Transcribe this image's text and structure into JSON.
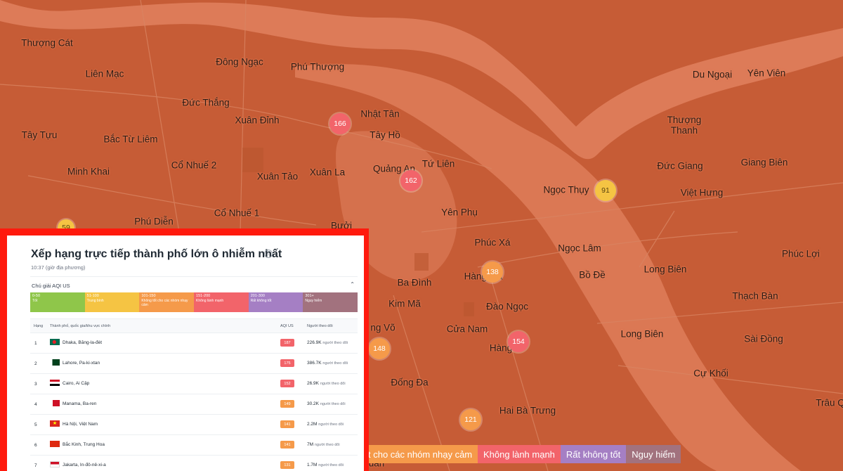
{
  "map": {
    "places": [
      {
        "id": "thuong-cat",
        "label": "Thượng Cát"
      },
      {
        "id": "dong-ngac",
        "label": "Đông Ngạc"
      },
      {
        "id": "phu-thuong",
        "label": "Phú Thượng"
      },
      {
        "id": "lien-mac",
        "label": "Liên Mạc"
      },
      {
        "id": "du-ngoai",
        "label": "Du Ngoại"
      },
      {
        "id": "yen-vien",
        "label": "Yên Viên"
      },
      {
        "id": "duc-thang",
        "label": "Đức Thắng"
      },
      {
        "id": "nhat-tan",
        "label": "Nhật Tân"
      },
      {
        "id": "xuan-dinh",
        "label": "Xuân Đỉnh"
      },
      {
        "id": "thuong-thanh",
        "label": "Thượng Thanh"
      },
      {
        "id": "tay-tuu",
        "label": "Tây Tựu"
      },
      {
        "id": "bac-tu-liem",
        "label": "Bắc Từ Liêm"
      },
      {
        "id": "tay-ho",
        "label": "Tây Hồ"
      },
      {
        "id": "co-nhue-2",
        "label": "Cổ Nhuế 2"
      },
      {
        "id": "duc-giang",
        "label": "Đức Giang"
      },
      {
        "id": "giang-bien",
        "label": "Giang Biên"
      },
      {
        "id": "tu-lien",
        "label": "Tứ Liên"
      },
      {
        "id": "minh-khai",
        "label": "Minh Khai"
      },
      {
        "id": "quang-an",
        "label": "Quảng An"
      },
      {
        "id": "xuan-la",
        "label": "Xuân La"
      },
      {
        "id": "xuan-tao",
        "label": "Xuân Tảo"
      },
      {
        "id": "ngoc-thuy",
        "label": "Ngọc Thụy"
      },
      {
        "id": "viet-hung",
        "label": "Việt Hưng"
      },
      {
        "id": "yen-phu",
        "label": "Yên Phụ"
      },
      {
        "id": "co-nhue-1",
        "label": "Cổ Nhuế 1"
      },
      {
        "id": "phu-dien",
        "label": "Phú Diễn"
      },
      {
        "id": "buoi",
        "label": "Bưởi"
      },
      {
        "id": "phuc-xa",
        "label": "Phúc Xá"
      },
      {
        "id": "ngoc-lam",
        "label": "Ngọc Lâm"
      },
      {
        "id": "phuc-loi",
        "label": "Phúc Lợi"
      },
      {
        "id": "bo-de",
        "label": "Bồ Đề"
      },
      {
        "id": "long-bien-1",
        "label": "Long Biên"
      },
      {
        "id": "ba-dinh",
        "label": "Ba Đình"
      },
      {
        "id": "hang-ma",
        "label": "Hàng Mã"
      },
      {
        "id": "thach-ban",
        "label": "Thạch Bàn"
      },
      {
        "id": "kim-ma",
        "label": "Kim Mã"
      },
      {
        "id": "dao-ngoc",
        "label": "Đào Ngọc"
      },
      {
        "id": "giang-vo",
        "label": "ng Võ"
      },
      {
        "id": "cua-nam",
        "label": "Cửa Nam"
      },
      {
        "id": "long-bien-2",
        "label": "Long Biên"
      },
      {
        "id": "sai-dong",
        "label": "Sài Đồng"
      },
      {
        "id": "hang-bai",
        "label": "Hàng"
      },
      {
        "id": "cu-khoi",
        "label": "Cự Khối"
      },
      {
        "id": "dong-da",
        "label": "Đống Đa"
      },
      {
        "id": "hai-ba-trung",
        "label": "Hai Bà Trưng"
      },
      {
        "id": "trau-quy",
        "label": "Trâu Q"
      },
      {
        "id": "hoang-mai",
        "label": "uan"
      }
    ],
    "markers": [
      {
        "id": "marker-166",
        "value": "166",
        "color": "#f2646a"
      },
      {
        "id": "marker-162",
        "value": "162",
        "color": "#f2646a"
      },
      {
        "id": "marker-91",
        "value": "91",
        "color": "#f5c443"
      },
      {
        "id": "marker-59",
        "value": "59",
        "color": "#f5c443"
      },
      {
        "id": "marker-138",
        "value": "138",
        "color": "#f59a4a"
      },
      {
        "id": "marker-154",
        "value": "154",
        "color": "#f2646a"
      },
      {
        "id": "marker-148",
        "value": "148",
        "color": "#f59a4a"
      },
      {
        "id": "marker-121",
        "value": "121",
        "color": "#f59a4a"
      }
    ],
    "legend": [
      {
        "label": "t cho các nhóm nhạy cảm",
        "color": "#f59a4a"
      },
      {
        "label": "Không lành mạnh",
        "color": "#f2646a"
      },
      {
        "label": "Rất không tốt",
        "color": "#a57fc4"
      },
      {
        "label": "Nguy hiểm",
        "color": "#a2727e"
      }
    ]
  },
  "panel": {
    "title": "Xếp hạng trực tiếp thành phố lớn ô nhiễm nhất",
    "info_icon": "info-icon",
    "time": "10:37 (giờ địa phương)",
    "legend_title": "Chú giải AQI US",
    "legend_segments": [
      {
        "range": "0-50",
        "label": "Tốt",
        "color": "#8fc64a"
      },
      {
        "range": "51-100",
        "label": "Trung bình",
        "color": "#f5c443"
      },
      {
        "range": "101-150",
        "label": "Không tốt cho các nhóm nhạy cảm",
        "color": "#f59a4a"
      },
      {
        "range": "151-200",
        "label": "Không lành mạnh",
        "color": "#f2646a"
      },
      {
        "range": "201-300",
        "label": "Rất không tốt",
        "color": "#a57fc4"
      },
      {
        "range": "301+",
        "label": "Nguy hiểm",
        "color": "#a2727e"
      }
    ],
    "columns": {
      "rank": "Hạng",
      "city": "Thành phố, quốc gia/khu vực chính",
      "aqi": "AQI US",
      "followers": "Người theo dõi"
    },
    "rows": [
      {
        "rank": "1",
        "city": "Dhaka, Băng-la-đét",
        "aqi": "187",
        "aqi_color": "#f2646a",
        "followers": "226.9K",
        "flag": "bd"
      },
      {
        "rank": "2",
        "city": "Lahore, Pa-ki-xtan",
        "aqi": "175",
        "aqi_color": "#f2646a",
        "followers": "386.7K",
        "flag": "pk"
      },
      {
        "rank": "3",
        "city": "Cairo, Ai Cập",
        "aqi": "152",
        "aqi_color": "#f2646a",
        "followers": "26.9K",
        "flag": "eg"
      },
      {
        "rank": "4",
        "city": "Manama, Ba-ren",
        "aqi": "149",
        "aqi_color": "#f59a4a",
        "followers": "30.2K",
        "flag": "bh"
      },
      {
        "rank": "5",
        "city": "Hà Nội, Việt Nam",
        "aqi": "141",
        "aqi_color": "#f59a4a",
        "followers": "2.2M",
        "flag": "vn"
      },
      {
        "rank": "6",
        "city": "Bắc Kinh, Trung Hoa",
        "aqi": "141",
        "aqi_color": "#f59a4a",
        "followers": "7M",
        "flag": "cn"
      },
      {
        "rank": "7",
        "city": "Jakarta, In-đô-nê-xi-a",
        "aqi": "131",
        "aqi_color": "#f59a4a",
        "followers": "1.7M",
        "flag": "id"
      }
    ],
    "followers_suffix": "người theo dõi"
  }
}
